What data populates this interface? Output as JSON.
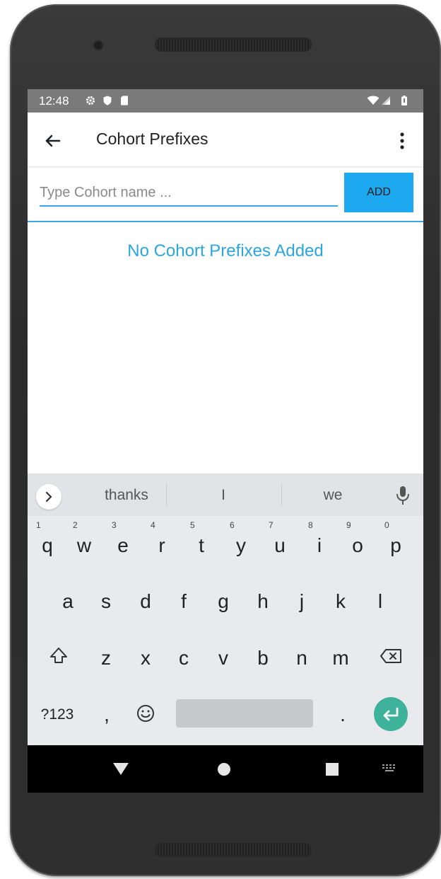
{
  "status_bar": {
    "time": "12:48"
  },
  "app_bar": {
    "title": "Cohort Prefixes"
  },
  "input": {
    "placeholder": "Type Cohort name ...",
    "value": ""
  },
  "add_button": {
    "label": "ADD"
  },
  "empty_state": {
    "message": "No Cohort Prefixes Added"
  },
  "colors": {
    "accent": "#1ca9ef",
    "text_accent": "#2ba6e3",
    "enter_key": "#3fb29c"
  },
  "keyboard": {
    "suggestions": [
      "thanks",
      "I",
      "we"
    ],
    "row1": [
      {
        "key": "q",
        "num": "1"
      },
      {
        "key": "w",
        "num": "2"
      },
      {
        "key": "e",
        "num": "3"
      },
      {
        "key": "r",
        "num": "4"
      },
      {
        "key": "t",
        "num": "5"
      },
      {
        "key": "y",
        "num": "6"
      },
      {
        "key": "u",
        "num": "7"
      },
      {
        "key": "i",
        "num": "8"
      },
      {
        "key": "o",
        "num": "9"
      },
      {
        "key": "p",
        "num": "0"
      }
    ],
    "row2": [
      "a",
      "s",
      "d",
      "f",
      "g",
      "h",
      "j",
      "k",
      "l"
    ],
    "row3": [
      "z",
      "x",
      "c",
      "v",
      "b",
      "n",
      "m"
    ],
    "row4": {
      "symbols": "?123",
      "comma": ",",
      "period": "."
    }
  }
}
